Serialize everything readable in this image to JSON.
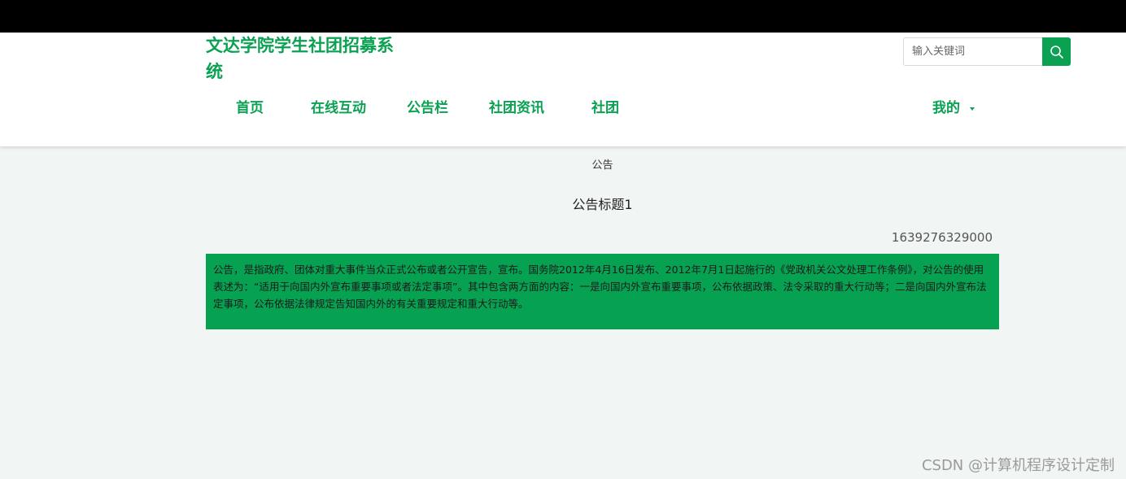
{
  "header": {
    "site_title": "文达学院学生社团招募系统",
    "search": {
      "placeholder": "输入关键词",
      "value": ""
    },
    "nav": {
      "items": [
        {
          "label": "首页"
        },
        {
          "label": "在线互动"
        },
        {
          "label": "公告栏"
        },
        {
          "label": "社团资讯"
        },
        {
          "label": "社团"
        }
      ],
      "user_menu_label": "我的"
    }
  },
  "main": {
    "breadcrumb": "公告",
    "title": "公告标题1",
    "timestamp": "1639276329000",
    "content": "公告，是指政府、团体对重大事件当众正式公布或者公开宣告，宣布。国务院2012年4月16日发布、2012年7月1日起施行的《党政机关公文处理工作条例》，对公告的使用表述为：“适用于向国内外宣布重要事项或者法定事项”。其中包含两方面的内容：一是向国内外宣布重要事项，公布依据政策、法令采取的重大行动等；二是向国内外宣布法定事项，公布依据法律规定告知国内外的有关重要规定和重大行动等。"
  },
  "watermark": "CSDN @计算机程序设计定制",
  "colors": {
    "accent": "#0aa152",
    "content_bg": "#07a152",
    "page_bg": "#f1f5f4"
  }
}
